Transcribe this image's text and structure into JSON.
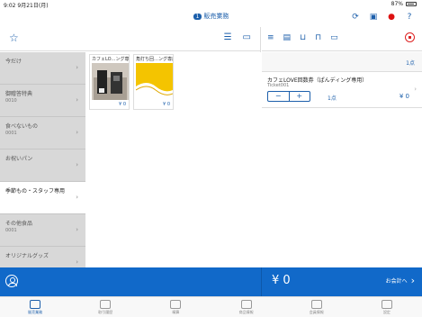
{
  "status": {
    "time": "9:02",
    "date": "9月21日(月)",
    "battery": "87%"
  },
  "nav": {
    "badge": "1",
    "title": "販売業務"
  },
  "categories": [
    {
      "name": "今だけ",
      "code": ""
    },
    {
      "name": "御贈答特典",
      "code": "0010"
    },
    {
      "name": "食べないもの",
      "code": "0001"
    },
    {
      "name": "お祝いパン",
      "code": ""
    },
    {
      "name": "季節もの・スタッフ専用",
      "code": ""
    },
    {
      "name": "その他食品",
      "code": "0001"
    },
    {
      "name": "オリジナルグッズ",
      "code": ""
    }
  ],
  "products": [
    {
      "title": "カフェLO…ング専用",
      "price": "¥ 0",
      "image": "coffee-machine"
    },
    {
      "title": "角打ち回…ング専用",
      "price": "¥ 0",
      "image": "yellow-wave"
    }
  ],
  "cart": {
    "count_label": "1点",
    "item_name": "カフェLOVE回数券（ぱんディング専用）",
    "item_code": "Ticket001",
    "qty_label": "1点",
    "item_price": "¥ 0",
    "minus": "−",
    "plus": "+"
  },
  "bottom": {
    "total": "¥ 0",
    "checkout": "お会計へ"
  },
  "tabs": [
    {
      "label": "販売業務",
      "active": true
    },
    {
      "label": "取引履歴"
    },
    {
      "label": "精算"
    },
    {
      "label": "商品情報"
    },
    {
      "label": "会員情報"
    },
    {
      "label": "設定"
    }
  ],
  "colors": {
    "accent": "#1c5fab",
    "bar": "#1169c9",
    "alert": "#dd1111"
  }
}
